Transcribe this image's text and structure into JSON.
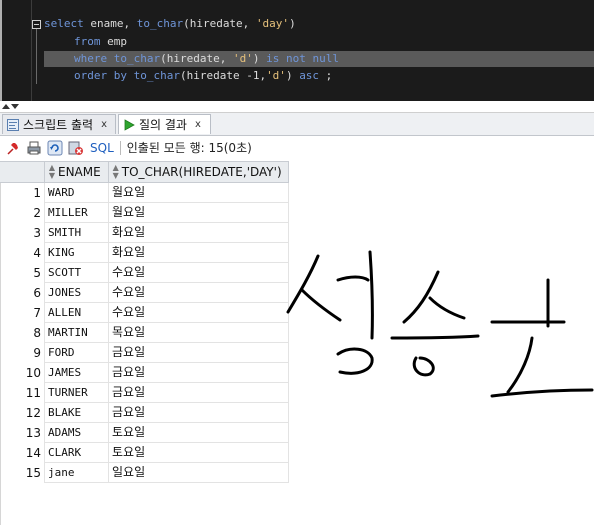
{
  "editor": {
    "lines": [
      {
        "parts": [
          [
            "kw",
            "select "
          ],
          [
            "id",
            "ename, "
          ],
          [
            "kw",
            "to_char"
          ],
          [
            "id",
            "(hiredate, "
          ],
          [
            "str",
            "'day'"
          ],
          [
            "id",
            ")"
          ]
        ]
      },
      {
        "parts": [
          [
            "kw",
            "from "
          ],
          [
            "id",
            "emp"
          ]
        ]
      },
      {
        "parts": [
          [
            "kw",
            "where "
          ],
          [
            "kw",
            "to_char"
          ],
          [
            "id",
            "(hiredate, "
          ],
          [
            "str",
            "'d'"
          ],
          [
            "id",
            ") "
          ],
          [
            "kw",
            "is not null"
          ]
        ]
      },
      {
        "parts": [
          [
            "kw",
            "order by "
          ],
          [
            "kw",
            "to_char"
          ],
          [
            "id",
            "(hiredate -1,"
          ],
          [
            "str",
            "'d'"
          ],
          [
            "id",
            ") "
          ],
          [
            "kw",
            "asc"
          ],
          [
            "id",
            " ;"
          ]
        ]
      }
    ]
  },
  "tabs": {
    "script_output": "스크립트 출력",
    "query_result": "질의 결과",
    "close": "x"
  },
  "toolbar": {
    "sql_label": "SQL",
    "separator": "|",
    "fetch_message": "인출된 모든 행: 15(0초)"
  },
  "grid": {
    "columns": [
      "ENAME",
      "TO_CHAR(HIREDATE,'DAY')"
    ],
    "rows": [
      [
        "1",
        "WARD",
        "월요일"
      ],
      [
        "2",
        "MILLER",
        "월요일"
      ],
      [
        "3",
        "SMITH",
        "화요일"
      ],
      [
        "4",
        "KING",
        "화요일"
      ],
      [
        "5",
        "SCOTT",
        "수요일"
      ],
      [
        "6",
        "JONES",
        "수요일"
      ],
      [
        "7",
        "ALLEN",
        "수요일"
      ],
      [
        "8",
        "MARTIN",
        "목요일"
      ],
      [
        "9",
        "FORD",
        "금요일"
      ],
      [
        "10",
        "JAMES",
        "금요일"
      ],
      [
        "11",
        "TURNER",
        "금요일"
      ],
      [
        "12",
        "BLAKE",
        "금요일"
      ],
      [
        "13",
        "ADAMS",
        "토요일"
      ],
      [
        "14",
        "CLARK",
        "토요일"
      ],
      [
        "15",
        "jane",
        "일요일"
      ]
    ]
  },
  "handwriting": {
    "text": "성승호",
    "color": "#000000"
  },
  "colors": {
    "editor_bg": "#1b1b1b",
    "keyword": "#6f95d8",
    "string": "#e5c07b",
    "highlight": "#5a5a5a"
  }
}
